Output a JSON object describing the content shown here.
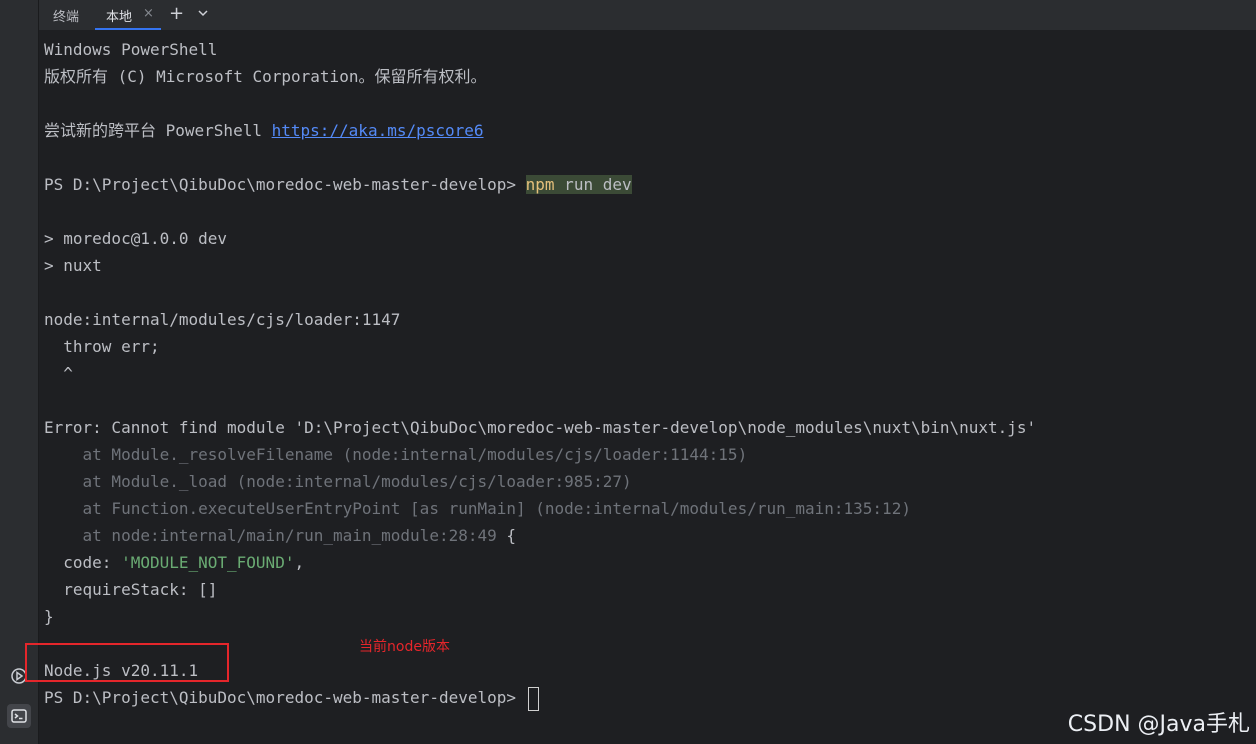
{
  "tabbar": {
    "title": "终端",
    "tab_label": "本地",
    "close_glyph": "×",
    "add_glyph": "+",
    "more_glyph": "⌄"
  },
  "icons": {
    "close": "close-icon",
    "add": "plus-icon",
    "more": "chevron-down-icon",
    "run": "run-icon",
    "terminal": "terminal-icon"
  },
  "terminal": {
    "l1": "Windows PowerShell",
    "l2": "版权所有 (C) Microsoft Corporation。保留所有权利。",
    "l4_prefix": "尝试新的跨平台 PowerShell ",
    "l4_link": "https://aka.ms/pscore6",
    "prompt": "PS D:\\Project\\QibuDoc\\moredoc-web-master-develop> ",
    "cmd_name": "npm",
    "cmd_args": " run dev",
    "l8": "> moredoc@1.0.0 dev",
    "l9": "> nuxt",
    "l11": "node:internal/modules/cjs/loader:1147",
    "l12": "  throw err;",
    "l13": "  ^",
    "l15": "Error: Cannot find module 'D:\\Project\\QibuDoc\\moredoc-web-master-develop\\node_modules\\nuxt\\bin\\nuxt.js'",
    "l16": "    at Module._resolveFilename (node:internal/modules/cjs/loader:1144:15)",
    "l17": "    at Module._load (node:internal/modules/cjs/loader:985:27)",
    "l18": "    at Function.executeUserEntryPoint [as runMain] (node:internal/modules/run_main:135:12)",
    "l19_dim": "    at node:internal/main/run_main_module:28:49",
    "l19_brace": " {",
    "l20_key": "  code: ",
    "l20_val": "'MODULE_NOT_FOUND'",
    "l20_end": ",",
    "l21": "  requireStack: []",
    "l22": "}",
    "l24": "Node.js v20.11.1",
    "final_prompt": "PS D:\\Project\\QibuDoc\\moredoc-web-master-develop> "
  },
  "annotation": "当前node版本",
  "watermark": "CSDN @Java手札",
  "colors": {
    "background": "#1e1f22",
    "text": "#bcbec4",
    "dim": "#6f737a",
    "string": "#6aab73",
    "link": "#548af7",
    "annotation": "#e5262b"
  }
}
